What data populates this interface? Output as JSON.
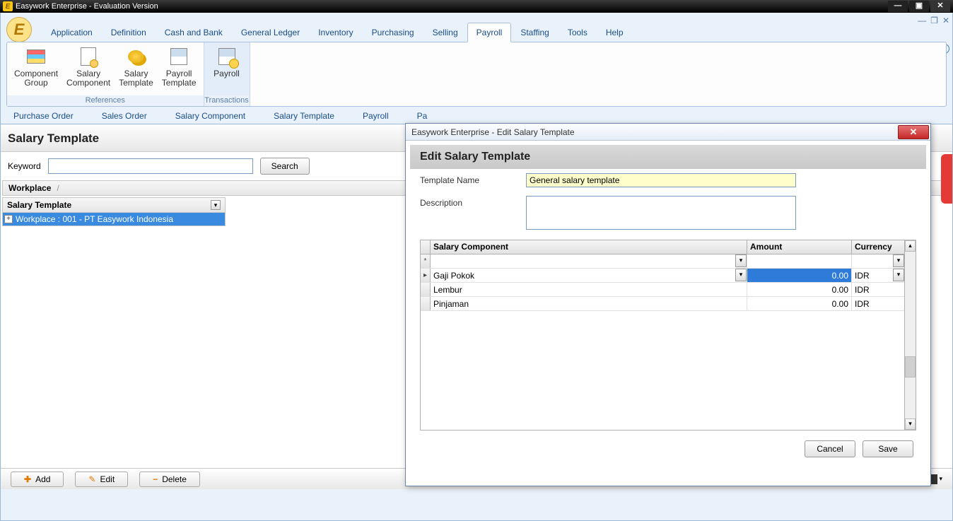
{
  "window": {
    "title": "Easywork Enterprise - Evaluation Version"
  },
  "menu": {
    "items": [
      "Application",
      "Definition",
      "Cash and Bank",
      "General Ledger",
      "Inventory",
      "Purchasing",
      "Selling",
      "Payroll",
      "Staffing",
      "Tools",
      "Help"
    ],
    "active": "Payroll"
  },
  "ribbon": {
    "references": {
      "label": "References",
      "buttons": [
        {
          "line1": "Component",
          "line2": "Group"
        },
        {
          "line1": "Salary",
          "line2": "Component"
        },
        {
          "line1": "Salary",
          "line2": "Template"
        },
        {
          "line1": "Payroll",
          "line2": "Template"
        }
      ]
    },
    "transactions": {
      "label": "Transactions",
      "buttons": [
        {
          "line1": "Payroll",
          "line2": ""
        }
      ]
    }
  },
  "docTabs": [
    "Purchase Order",
    "Sales Order",
    "Salary Component",
    "Salary Template",
    "Payroll",
    "Pa"
  ],
  "page": {
    "title": "Salary Template",
    "keywordLabel": "Keyword",
    "keywordValue": "",
    "searchLabel": "Search",
    "breadcrumb": {
      "root": "Workplace",
      "sep": "/"
    },
    "gridHeader": "Salary Template",
    "rows": [
      "Workplace : 001 - PT Easywork Indonesia"
    ]
  },
  "bottom": {
    "add": "Add",
    "edit": "Edit",
    "delete": "Delete"
  },
  "dialog": {
    "title": "Easywork Enterprise - Edit Salary Template",
    "heading": "Edit Salary Template",
    "templateNameLabel": "Template Name",
    "templateNameValue": "General salary template",
    "descriptionLabel": "Description",
    "descriptionValue": "",
    "columns": {
      "comp": "Salary Component",
      "amt": "Amount",
      "cur": "Currency"
    },
    "rows": [
      {
        "comp": "Gaji Pokok",
        "amt": "0.00",
        "cur": "IDR",
        "selected": true
      },
      {
        "comp": "Lembur",
        "amt": "0.00",
        "cur": "IDR",
        "selected": false
      },
      {
        "comp": "Pinjaman",
        "amt": "0.00",
        "cur": "IDR",
        "selected": false
      }
    ],
    "cancel": "Cancel",
    "save": "Save"
  }
}
